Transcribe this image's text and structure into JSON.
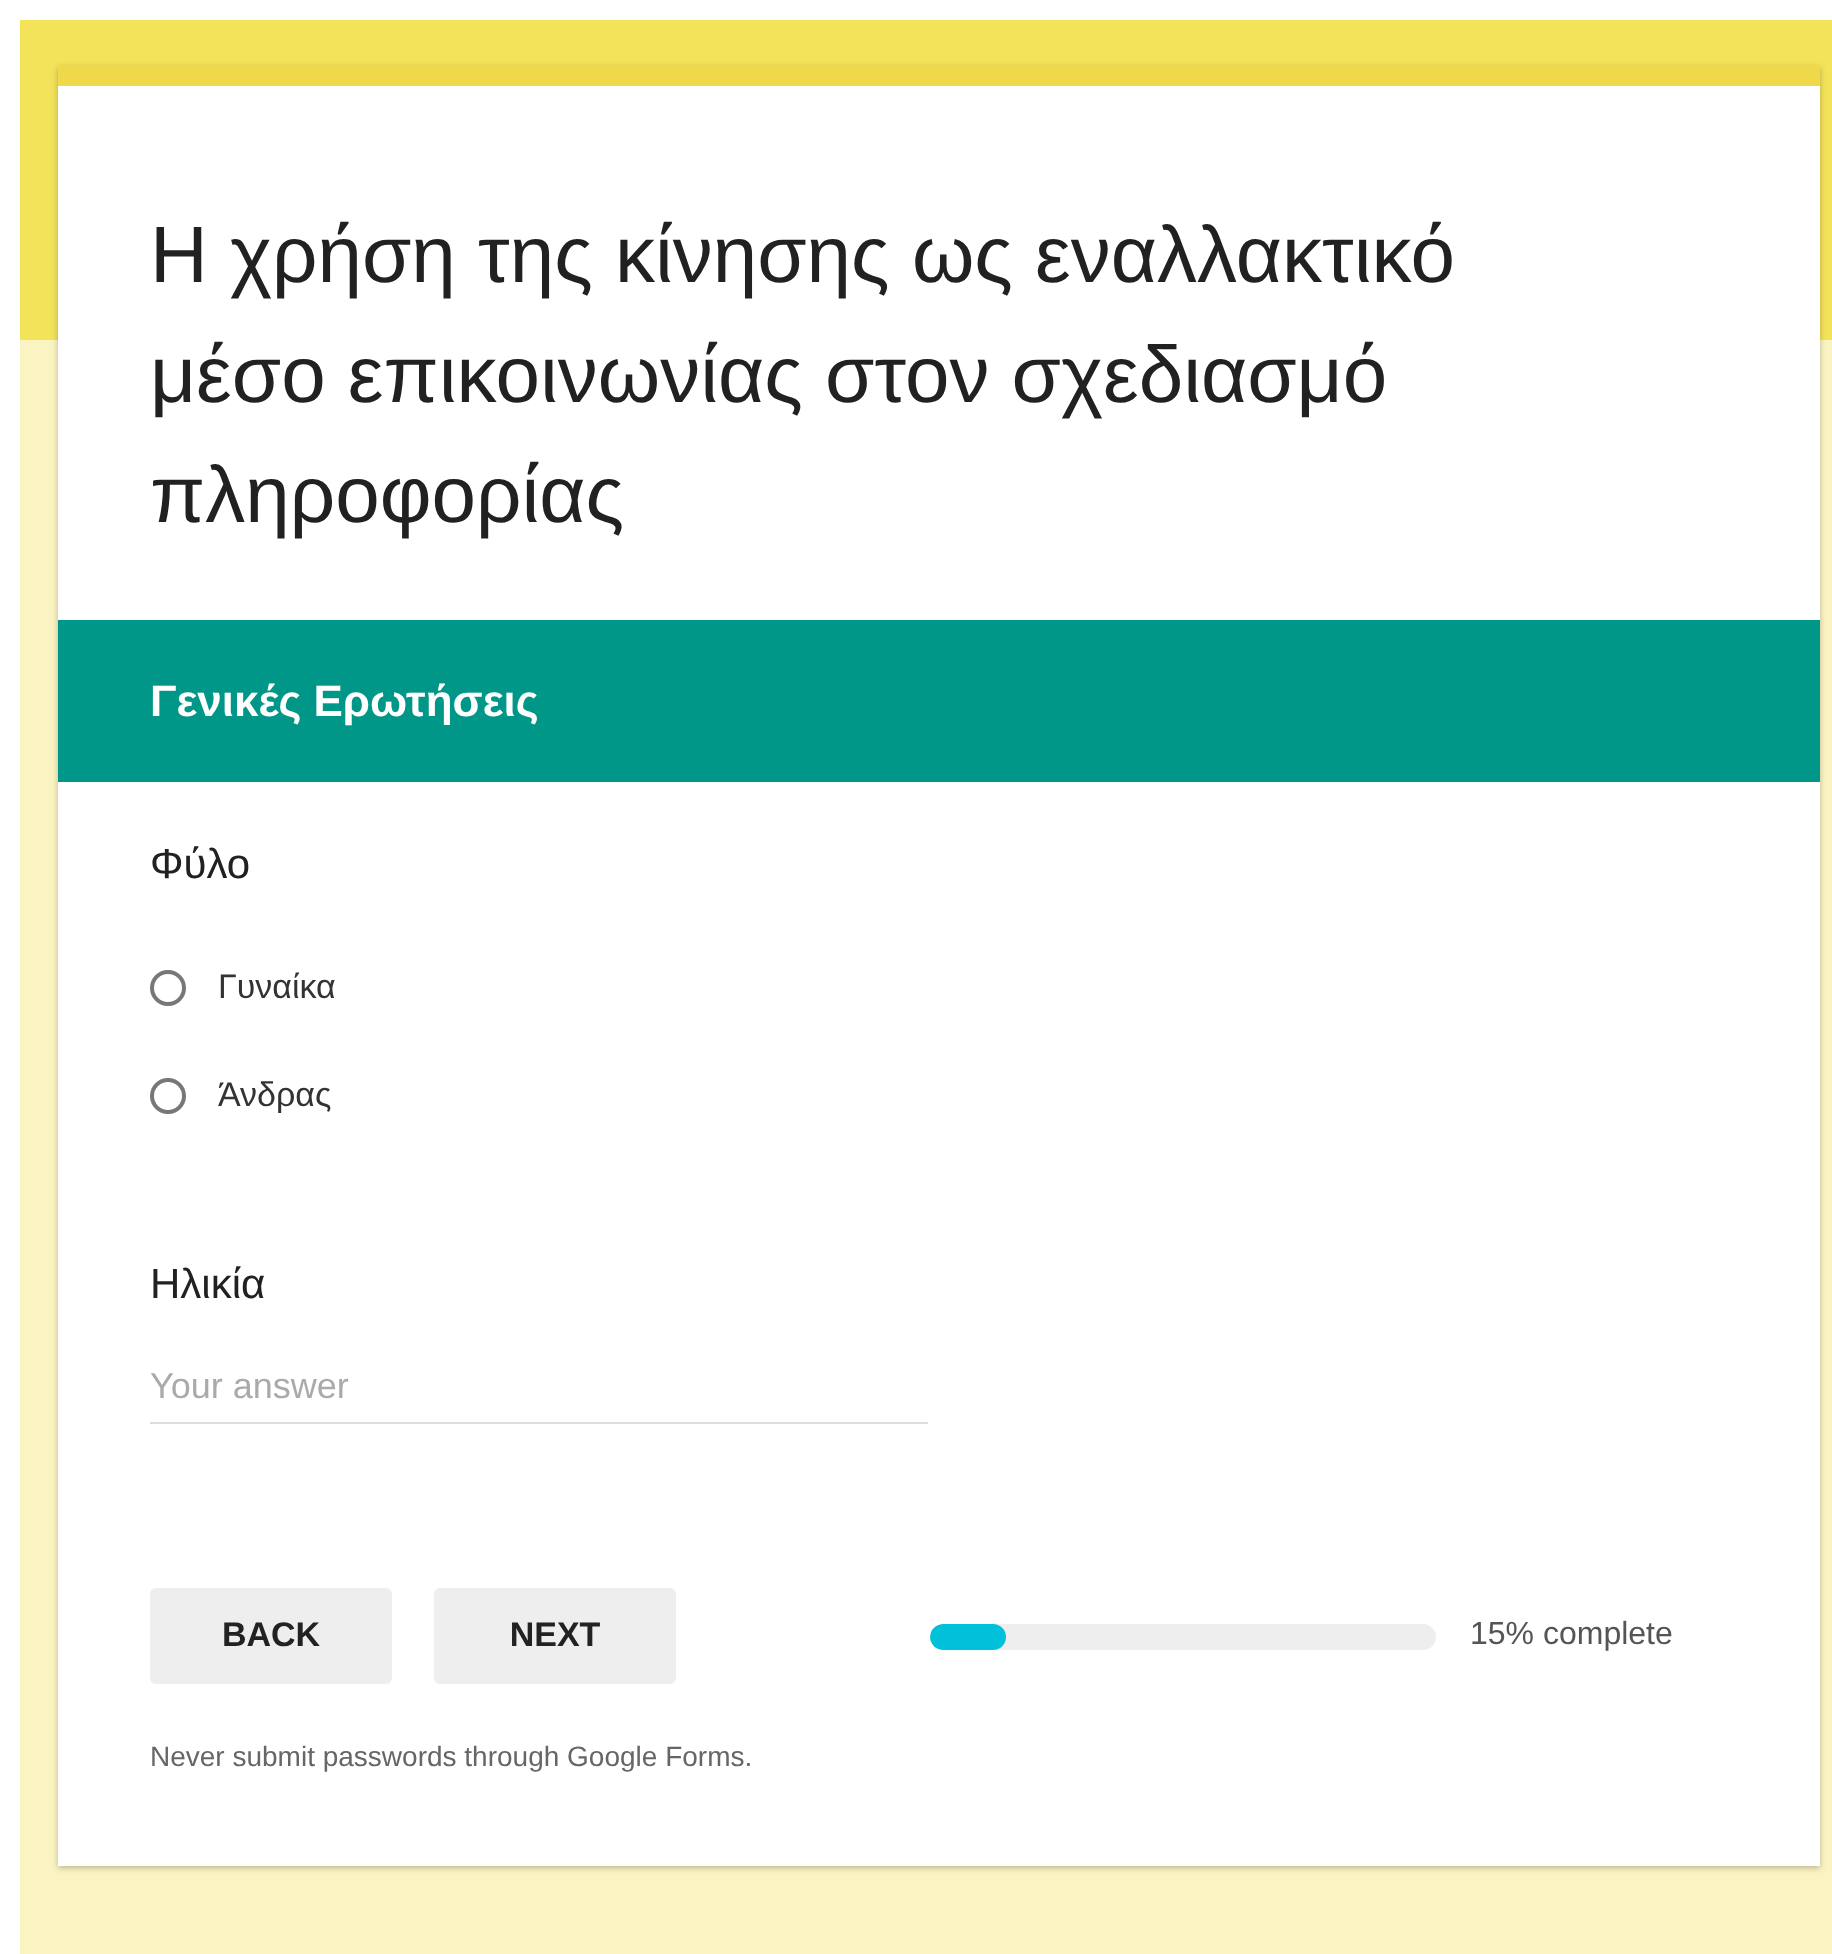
{
  "form": {
    "title": "Η χρήση της κίνησης ως εναλλακτικό μέσο επικοινωνίας στον σχεδιασμό πληροφορίας"
  },
  "section": {
    "title": "Γενικές Ερωτήσεις"
  },
  "questions": [
    {
      "kind": "radio",
      "title": "Φύλο",
      "options": [
        {
          "label": "Γυναίκα",
          "selected": false
        },
        {
          "label": "Άνδρας",
          "selected": false
        }
      ]
    },
    {
      "kind": "text",
      "title": "Ηλικία",
      "placeholder": "Your answer"
    }
  ],
  "buttons": [
    "BACK",
    "NEXT"
  ],
  "progress": {
    "level": 0.15,
    "reading": "15% complete"
  },
  "footer": "Never submit passwords through Google Forms."
}
